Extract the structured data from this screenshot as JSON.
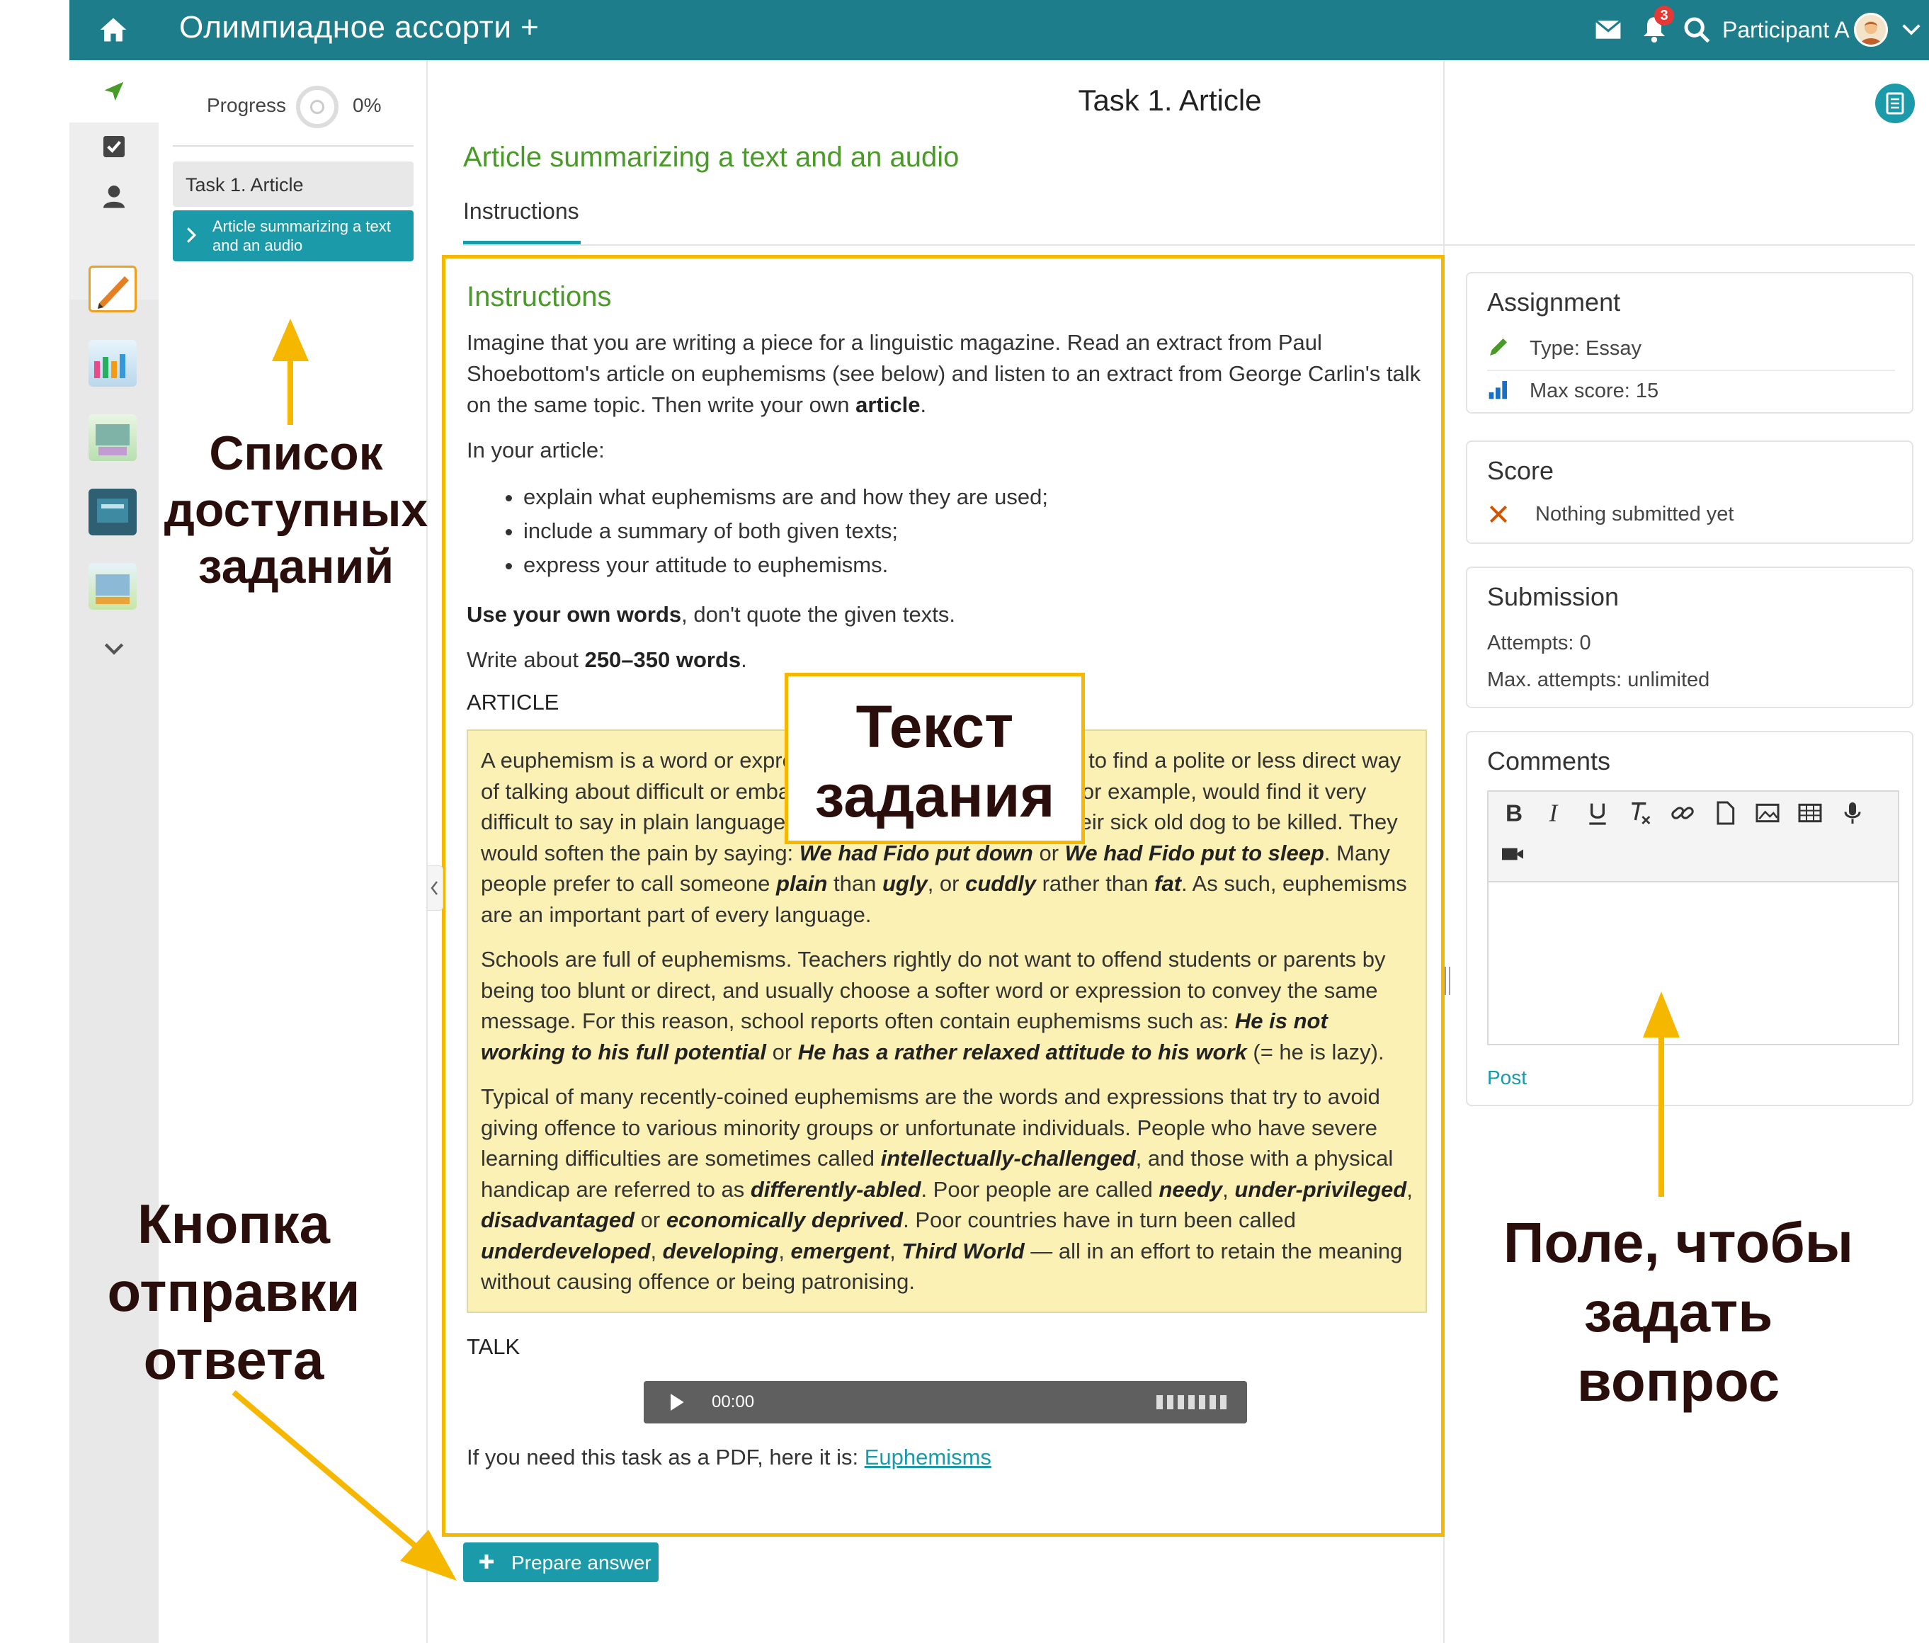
{
  "topbar": {
    "app_title": "Олимпиадное ассорти +",
    "notifications_count": "3",
    "user_name": "Participant A",
    "color": "#1d7d8a"
  },
  "icons": {
    "home": "home-icon",
    "mail": "mail-icon",
    "bell": "bell-icon",
    "search": "search-icon",
    "rail": [
      "navigate-icon",
      "tasks-check-icon",
      "person-icon",
      "chevron-down-icon"
    ]
  },
  "sidebar": {
    "progress_label": "Progress",
    "progress_value": "0%",
    "progress_fraction": 0,
    "task_label": "Task 1. Article",
    "subtask_label": "Article summarizing a text and an audio"
  },
  "main": {
    "page_title": "Task 1. Article",
    "subtitle": "Article summarizing a text and an audio",
    "tab_label": "Instructions",
    "instructions_heading": "Instructions",
    "intro_text": "Imagine that you are writing a piece for a linguistic magazine. Read an extract from Paul Shoebottom's article on euphemisms (see below) and listen to an extract from George Carlin's talk on the same topic. Then write your own ",
    "intro_bold": "article",
    "intro_end": ".",
    "in_your_article": "In your article:",
    "bullets": [
      "explain what euphemisms are and how they are used;",
      "include a summary of both given texts;",
      "express your attitude to euphemisms."
    ],
    "own_words_bold": "Use your own words",
    "own_words_rest": ", don't quote the given texts.",
    "write_about": "Write about ",
    "word_count_bold": "250–350 words",
    "write_about_end": ".",
    "article_label": "ARTICLE",
    "article": {
      "p1": [
        "A euphemism is a word or expression used when people want to find a polite or less direct way of talking about difficult or embarrassing topics. Most people, for example, would find it very difficult to say in plain language that they have arranged for their sick old dog to be killed. They would soften the pain by saying: ",
        "We had Fido put down",
        " or ",
        "We had Fido put to sleep",
        ". Many people prefer to call someone ",
        "plain",
        " than ",
        "ugly",
        ", or ",
        "cuddly",
        " rather than ",
        "fat",
        ". As such, euphemisms are an important part of every language."
      ],
      "p2": [
        "Schools are full of euphemisms. Teachers rightly do not want to offend students or parents by being too blunt or direct, and usually choose a softer word or expression to convey the same message. For this reason, school reports often contain euphemisms such as: ",
        "He is not working to his full potential",
        " or ",
        "He has a rather relaxed attitude to his work",
        " (= he is lazy)."
      ],
      "p3": [
        "Typical of many recently-coined euphemisms are the words and expressions that try to avoid giving offence to various minority groups or unfortunate individuals. People who have severe learning difficulties are sometimes called ",
        "intellectually-challenged",
        ", and those with a physical handicap are referred to as ",
        "differently-abled",
        ". Poor people are called ",
        "needy",
        ", ",
        "under-privileged",
        ", ",
        "disadvantaged",
        " or ",
        "economically deprived",
        ". Poor countries have in turn been called ",
        "underdeveloped",
        ", ",
        "developing",
        ", ",
        "emergent",
        ", ",
        "Third World",
        " — all in an effort to retain the meaning without causing offence or being patronising."
      ]
    },
    "talk_label": "TALK",
    "audio_time": "00:00",
    "pdf_text": "If you need this task as a PDF, here it is: ",
    "pdf_link": "Euphemisms",
    "prepare_button": "Prepare answer"
  },
  "right_panel": {
    "assignment": {
      "title": "Assignment",
      "type": "Type: Essay",
      "max_score": "Max score: 15"
    },
    "score": {
      "title": "Score",
      "status": "Nothing submitted yet"
    },
    "submission": {
      "title": "Submission",
      "attempts": "Attempts: 0",
      "max_attempts": "Max. attempts: unlimited"
    },
    "comments": {
      "title": "Comments",
      "post": "Post"
    }
  },
  "annotations": {
    "task_list": [
      "Список",
      "доступных",
      "заданий"
    ],
    "task_text": [
      "Текст",
      "задания"
    ],
    "submit_button": [
      "Кнопка",
      "отправки",
      "ответа"
    ],
    "question_field": [
      "Поле, чтобы",
      "задать",
      "вопрос"
    ],
    "accent_color": "#f5b700"
  }
}
